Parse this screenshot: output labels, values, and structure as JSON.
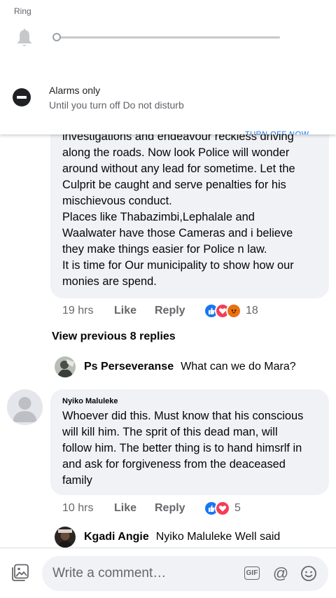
{
  "volume_panel": {
    "ring_label": "Ring",
    "ring_level": 0.0,
    "dnd_title": "Alarms only",
    "dnd_subtitle": "Until you turn off Do not disturb",
    "turn_off_label": "TURN OFF NOW"
  },
  "comments": [
    {
      "text": "investigations and endeavour reckless driving\nalong the roads. Now look Police will wonder\naround without any lead for sometime.  Let the\nCulprit be caught and serve penalties for his\nmischievous conduct.\nPlaces like Thabazimbi,Lephalale and\nWaalwater have those Cameras and i believe\nthey make things easier for Police n law.\nIt is time for Our municipality to show how our\nmonies are spend.",
      "time": "19 hrs",
      "like_label": "Like",
      "reply_label": "Reply",
      "reactions": [
        "like",
        "love",
        "angry"
      ],
      "reaction_count": "18"
    },
    {
      "author": "Nyiko Maluleke",
      "text": "Whoever did this. Must know that his conscious\nwill kill him. The sprit of this dead man, will\nfollow him. The better thing is to hand himsrlf in\n and ask for forgiveness from the deaceased\nfamily",
      "time": "10 hrs",
      "like_label": "Like",
      "reply_label": "Reply",
      "reactions": [
        "like",
        "love"
      ],
      "reaction_count": "5"
    }
  ],
  "view_previous": "View previous 8 replies",
  "replies": [
    {
      "author": "Ps Perseveranse",
      "text": "What can we do Mara?"
    },
    {
      "author": "Kgadi Angie",
      "text": "Nyiko Maluleke Well said"
    }
  ],
  "composer": {
    "placeholder": "Write a comment…",
    "gif_label": "GIF",
    "at_label": "@"
  },
  "colors": {
    "like_blue": "#1877f2",
    "love_red": "#f33e58",
    "angry_orange": "#e9710f",
    "bubble_grey": "#f0f2f5"
  },
  "icons": [
    "bell-icon",
    "dnd-icon",
    "like-reaction-icon",
    "love-reaction-icon",
    "angry-reaction-icon",
    "photo-icon",
    "gif-icon",
    "at-icon",
    "emoji-icon"
  ]
}
